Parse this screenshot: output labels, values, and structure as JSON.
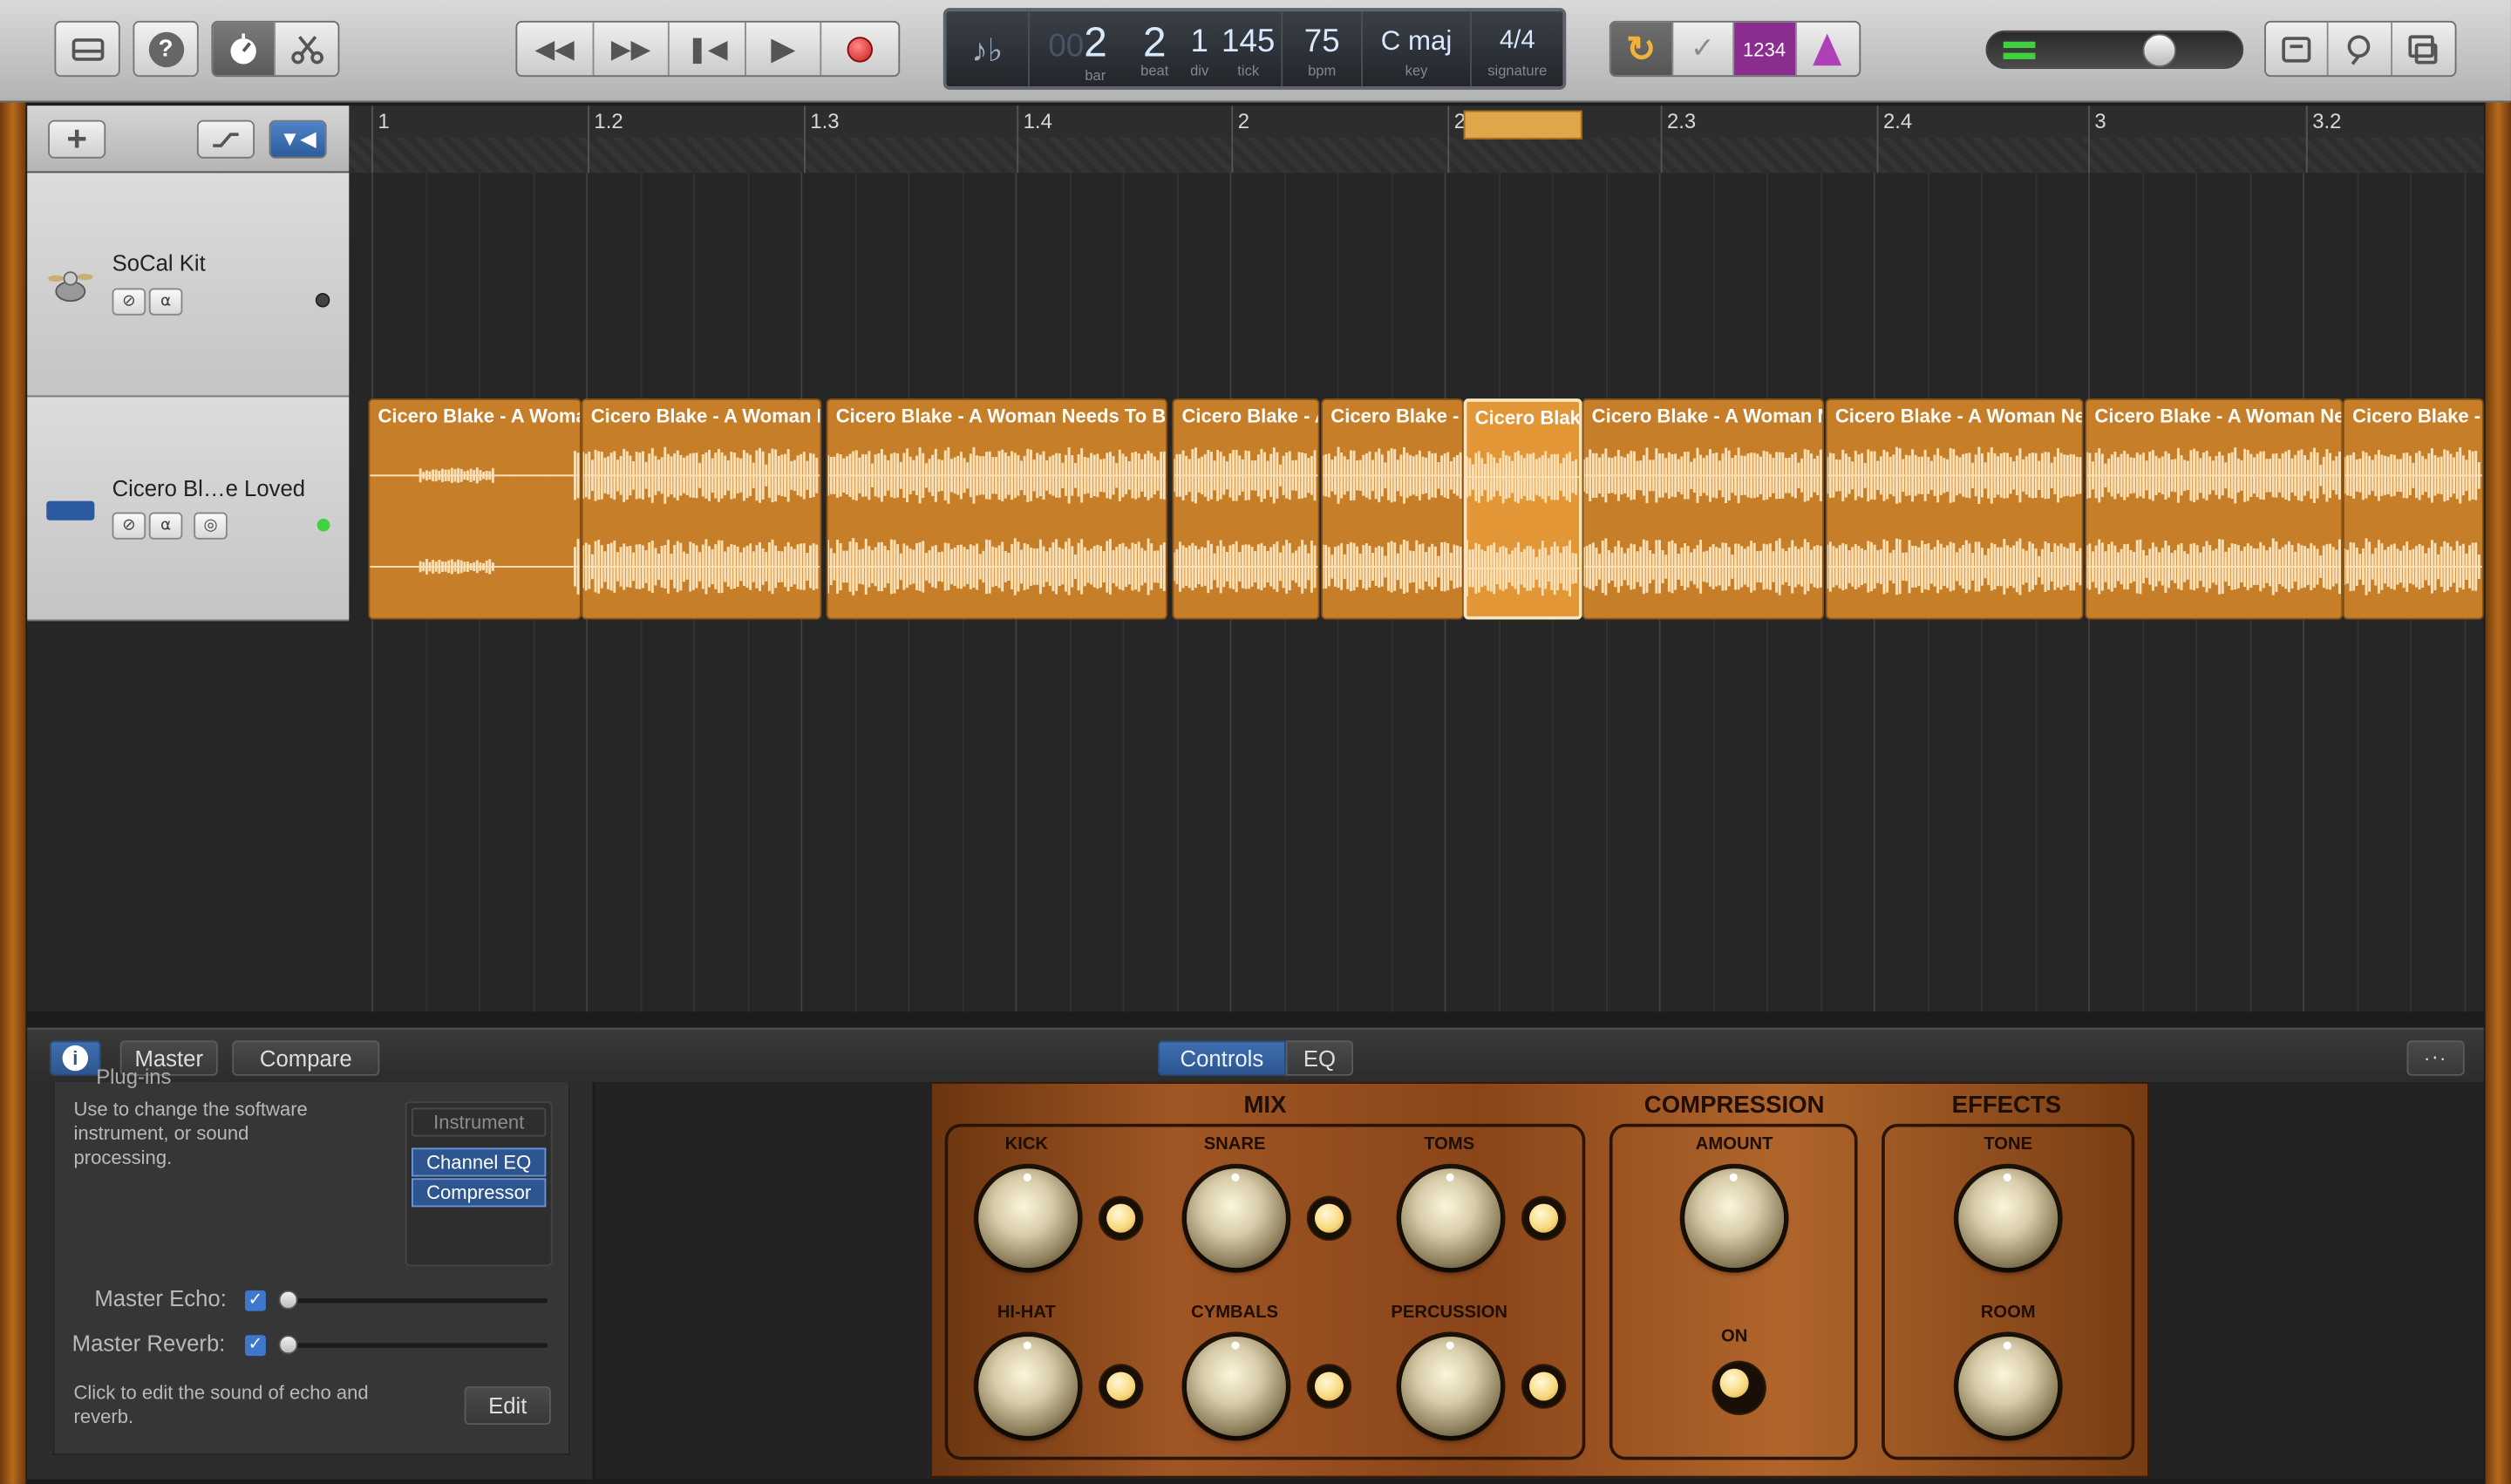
{
  "toolbar": {
    "left_buttons": [
      "library-icon",
      "help-icon",
      "smart-controls-icon",
      "scissors-editors-icon"
    ],
    "help_label": "?",
    "transport": [
      "rewind-icon",
      "fast-forward-icon",
      "go-to-beginning-icon",
      "play-icon",
      "record-icon"
    ],
    "right_buttons": [
      "cycle-icon",
      "tuner-icon",
      "count-in-icon",
      "metronome-icon"
    ],
    "count_in_label": "1234",
    "far_right": [
      "notepad-icon",
      "loop-browser-icon",
      "media-browser-icon"
    ],
    "colors": {
      "cycle": "#f0b23a",
      "count_in": "#8a2d8f",
      "accent": "#3f6fb0"
    }
  },
  "lcd": {
    "bar": "2",
    "bar_prefix": "00",
    "beat": "2",
    "div": "1",
    "tick": "145",
    "bpm": "75",
    "key": "C maj",
    "signature": "4/4",
    "labels": {
      "bar": "bar",
      "beat": "beat",
      "div": "div",
      "tick": "tick",
      "bpm": "bpm",
      "key": "key",
      "signature": "signature"
    }
  },
  "ruler": {
    "marks": [
      "1",
      "1.2",
      "1.3",
      "1.4",
      "2",
      "2.2",
      "2.3",
      "2.4",
      "3",
      "3.2"
    ]
  },
  "tracks": [
    {
      "name": "SoCal Kit",
      "icon": "drum-kit-icon"
    },
    {
      "name": "Cicero Bl…e Loved",
      "icon": "audio-waveform-icon"
    }
  ],
  "regions": [
    {
      "name": "Cicero Blake - A Woman Needs To Be Loved"
    },
    {
      "name": "Cicero Blake - A Woman Needs To Be Loved"
    },
    {
      "name": "Cicero Blake - A Woman Needs To Be Loved"
    },
    {
      "name": "Cicero Blake - A Woman Needs To Be Loved"
    },
    {
      "name": "Cicero Blake - A Woman Needs To Be Loved"
    },
    {
      "name": "Cicero Blake - A Woman Needs To Be Loved"
    },
    {
      "name": "Cicero Blake - A Woman Needs To Be Loved"
    },
    {
      "name": "Cicero Blake - A Woman Needs To Be Loved"
    },
    {
      "name": "Cicero Blake - A Woman Needs To Be Loved"
    },
    {
      "name": "Cicero Blake - A Woman Needs To Be Loved"
    }
  ],
  "editor": {
    "master_label": "Master",
    "compare_label": "Compare",
    "tabs": [
      "Controls",
      "EQ"
    ],
    "panel_title": "Plug-ins",
    "panel_desc": "Use to change the software instrument, or sound processing.",
    "instrument_label": "Instrument",
    "plugins": [
      "Channel EQ",
      "Compressor"
    ],
    "master_echo_label": "Master Echo:",
    "master_reverb_label": "Master Reverb:",
    "master_echo_value": 0,
    "master_reverb_value": 0,
    "edit_desc": "Click to edit the sound of echo and reverb.",
    "edit_label": "Edit"
  },
  "drum_kit": {
    "mix_title": "MIX",
    "compression_title": "COMPRESSION",
    "effects_title": "EFFECTS",
    "mix_knobs": [
      "KICK",
      "SNARE",
      "TOMS",
      "HI-HAT",
      "CYMBALS",
      "PERCUSSION"
    ],
    "compression_knob": "AMOUNT",
    "compression_switch": "ON",
    "effect_knobs": [
      "TONE",
      "ROOM"
    ]
  }
}
